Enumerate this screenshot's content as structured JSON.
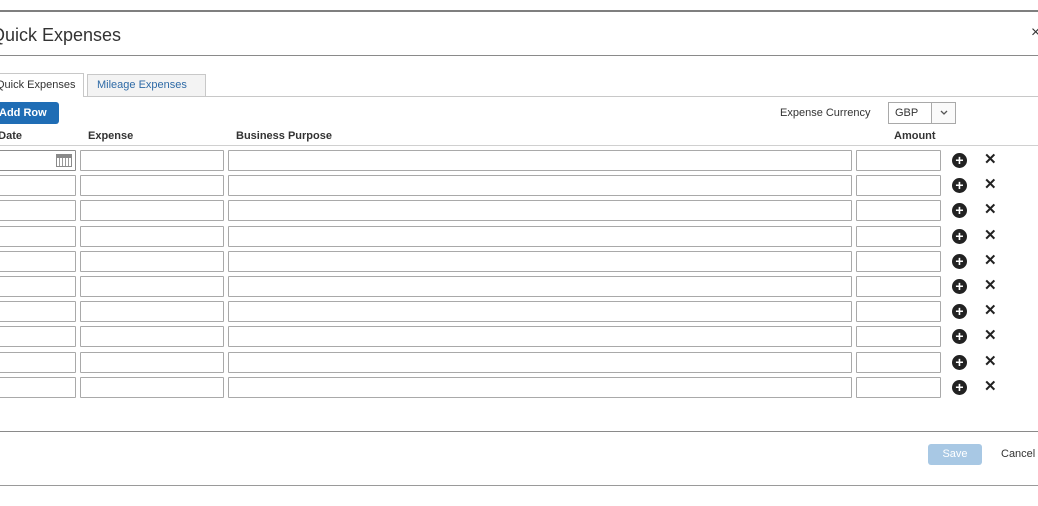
{
  "dialog": {
    "title": "Quick Expenses",
    "close_glyph": "×"
  },
  "tabs": [
    {
      "label": "Quick Expenses",
      "active": true
    },
    {
      "label": "Mileage Expenses",
      "active": false
    }
  ],
  "toolbar": {
    "add_row_label": "Add Row",
    "currency_label": "Expense Currency",
    "currency_value": "GBP"
  },
  "table": {
    "columns": [
      "Date",
      "Expense",
      "Business Purpose",
      "Amount"
    ],
    "row_count": 10
  },
  "footer": {
    "save_label": "Save",
    "cancel_label": "Cancel"
  },
  "icons": {
    "add": "plus-circle-icon",
    "remove": "x-icon",
    "calendar": "calendar-icon",
    "dropdown": "chevron-down-icon"
  },
  "colors": {
    "primary_button": "#1f6db5",
    "disabled_button": "#a8c8e4",
    "tab_link": "#2e6aa6"
  }
}
